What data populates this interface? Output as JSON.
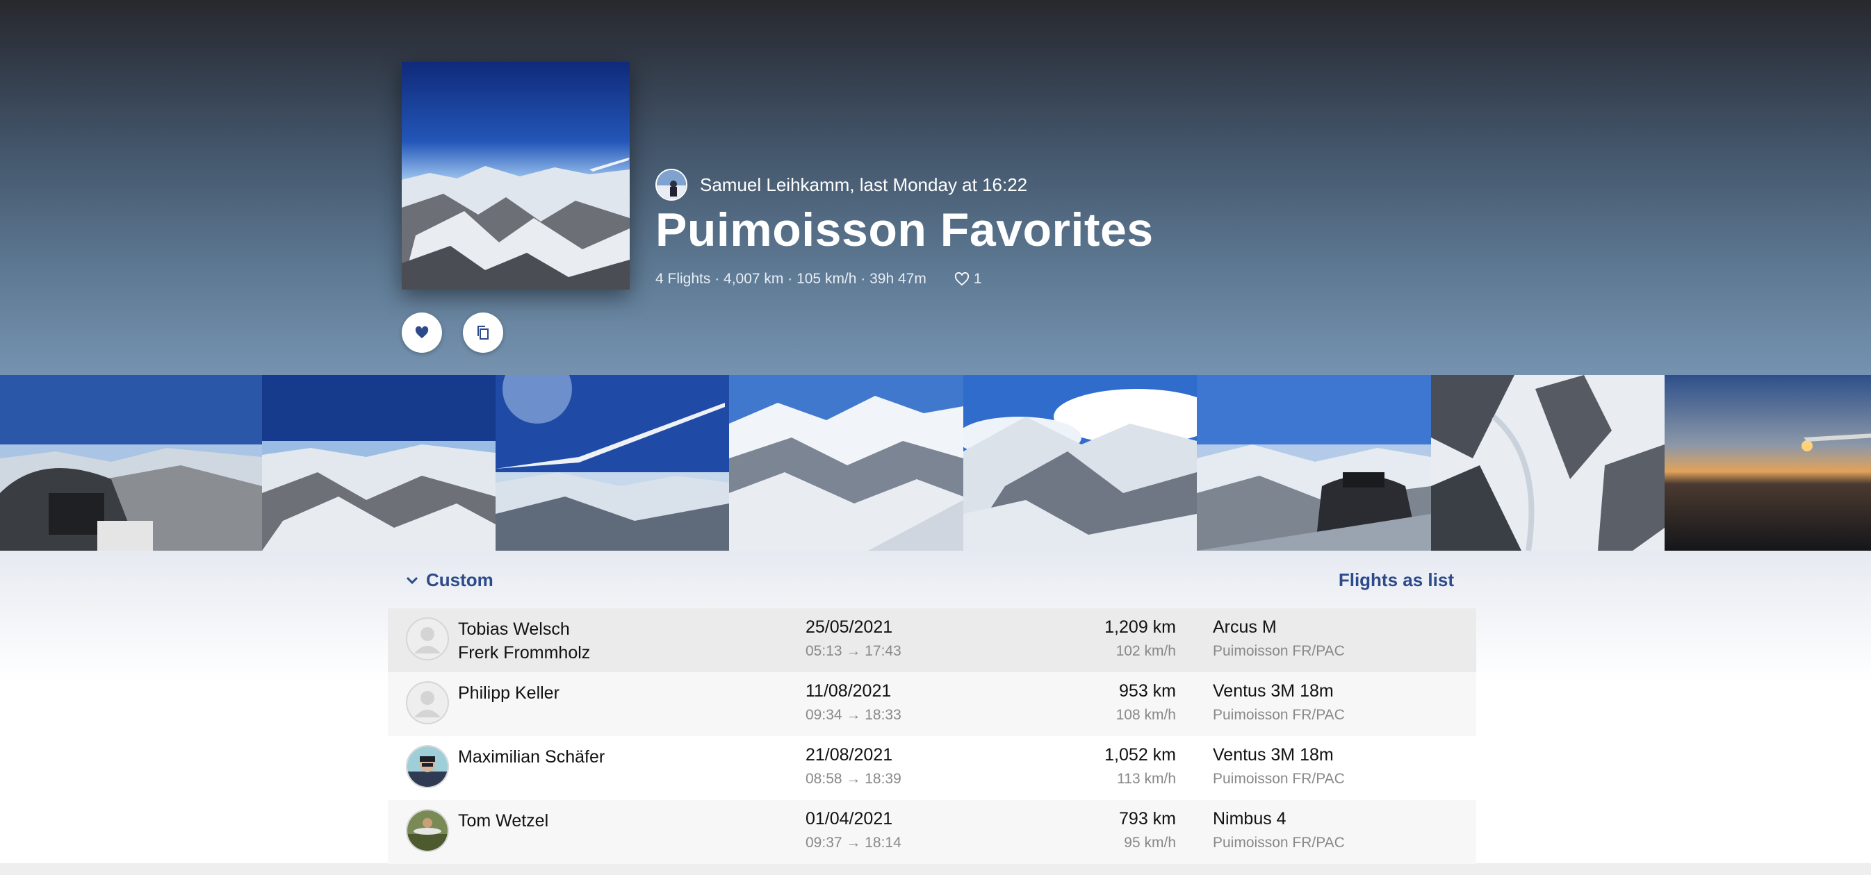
{
  "collection": {
    "author_line": "Samuel Leihkamm, last Monday at 16:22",
    "title": "Puimoisson Favorites",
    "stats": "4 Flights · 4,007 km · 105 km/h · 39h 47m",
    "likes": "1"
  },
  "actions": {
    "like_icon": "heart-icon",
    "copy_icon": "copy-icon"
  },
  "list": {
    "sort_label": "Custom",
    "view_link": "Flights as list"
  },
  "flights": [
    {
      "pilot": "Tobias Welsch",
      "copilot": "Frerk Frommholz",
      "date": "25/05/2021",
      "times": "05:13 → 17:43",
      "distance": "1,209 km",
      "speed": "102 km/h",
      "glider": "Arcus M",
      "site": "Puimoisson FR/PAC"
    },
    {
      "pilot": "Philipp Keller",
      "copilot": "",
      "date": "11/08/2021",
      "times": "09:34 → 18:33",
      "distance": "953 km",
      "speed": "108 km/h",
      "glider": "Ventus 3M 18m",
      "site": "Puimoisson FR/PAC"
    },
    {
      "pilot": "Maximilian Schäfer",
      "copilot": "",
      "date": "21/08/2021",
      "times": "08:58 → 18:39",
      "distance": "1,052 km",
      "speed": "113 km/h",
      "glider": "Ventus 3M 18m",
      "site": "Puimoisson FR/PAC"
    },
    {
      "pilot": "Tom Wetzel",
      "copilot": "",
      "date": "01/04/2021",
      "times": "09:37 → 18:14",
      "distance": "793 km",
      "speed": "95 km/h",
      "glider": "Nimbus 4",
      "site": "Puimoisson FR/PAC"
    }
  ],
  "colors": {
    "accent": "#2d4a8a",
    "row_highlight": "#ebebeb",
    "row_alt": "#f7f7f7"
  }
}
